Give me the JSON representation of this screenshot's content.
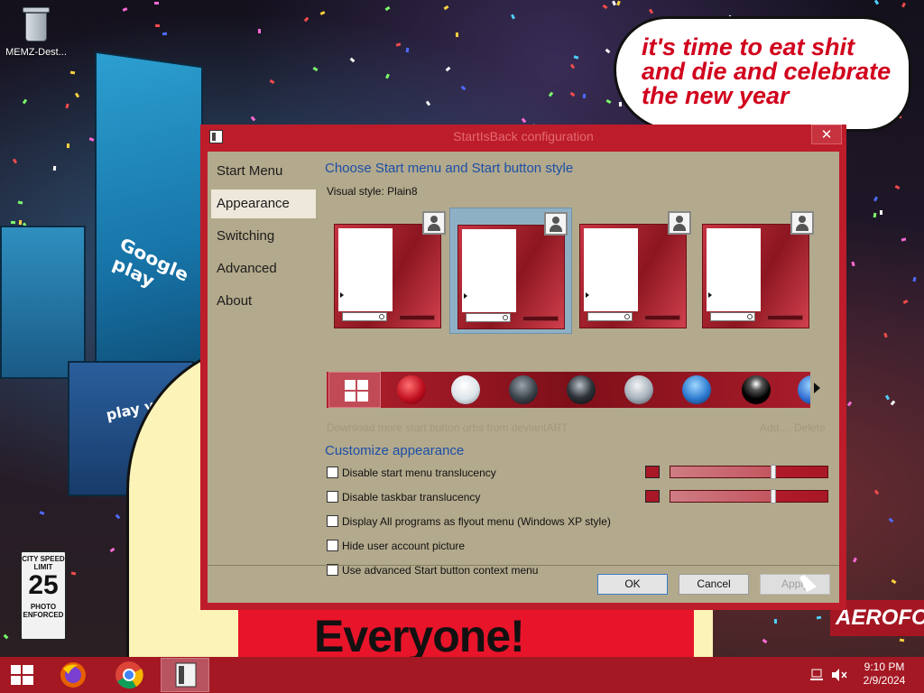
{
  "desktop": {
    "recycle_bin_label": "MEMZ-Dest...",
    "speech_bubble_lines": [
      "it's time to eat shit",
      "and die and celebrate",
      "the new year"
    ],
    "banner_text": "Everyone!",
    "right_sign_text": "AEROFOS",
    "speed_sign": {
      "top": "CITY SPEED LIMIT",
      "value": "25",
      "bottom": "PHOTO ENFORCED"
    }
  },
  "window": {
    "title": "StartIsBack configuration",
    "close_label": "✕",
    "nav": [
      {
        "label": "Start Menu",
        "selected": false
      },
      {
        "label": "Appearance",
        "selected": true
      },
      {
        "label": "Switching",
        "selected": false
      },
      {
        "label": "Advanced",
        "selected": false
      },
      {
        "label": "About",
        "selected": false
      }
    ],
    "style_section_title": "Choose Start menu and Start button style",
    "visual_style_label": "Visual style:",
    "visual_style_value": "Plain8",
    "style_thumbnails_selected_index": 1,
    "download_link": "Download more start button orbs from deviantART",
    "add_link": "Add...",
    "delete_link": "Delete",
    "customize_title": "Customize appearance",
    "options": [
      {
        "label": "Disable start menu translucency",
        "checked": false,
        "slider_level": 0.65
      },
      {
        "label": "Disable taskbar translucency",
        "checked": false,
        "slider_level": 0.65
      },
      {
        "label": "Display All programs as flyout menu (Windows XP style)",
        "checked": false
      },
      {
        "label": "Hide user account picture",
        "checked": false
      },
      {
        "label": "Use advanced Start button context menu",
        "checked": false
      }
    ],
    "buttons": {
      "ok": "OK",
      "cancel": "Cancel",
      "apply": "Apply"
    }
  },
  "taskbar": {
    "apps": [
      "windows-start",
      "firefox",
      "chrome",
      "startisback-config"
    ],
    "time": "9:10 PM",
    "date": "2/9/2024"
  },
  "colors": {
    "window_frame": "#bd1c2a",
    "client_bg": "#b3a98c",
    "link_blue": "#1c4fa8",
    "taskbar": "#a31823"
  }
}
